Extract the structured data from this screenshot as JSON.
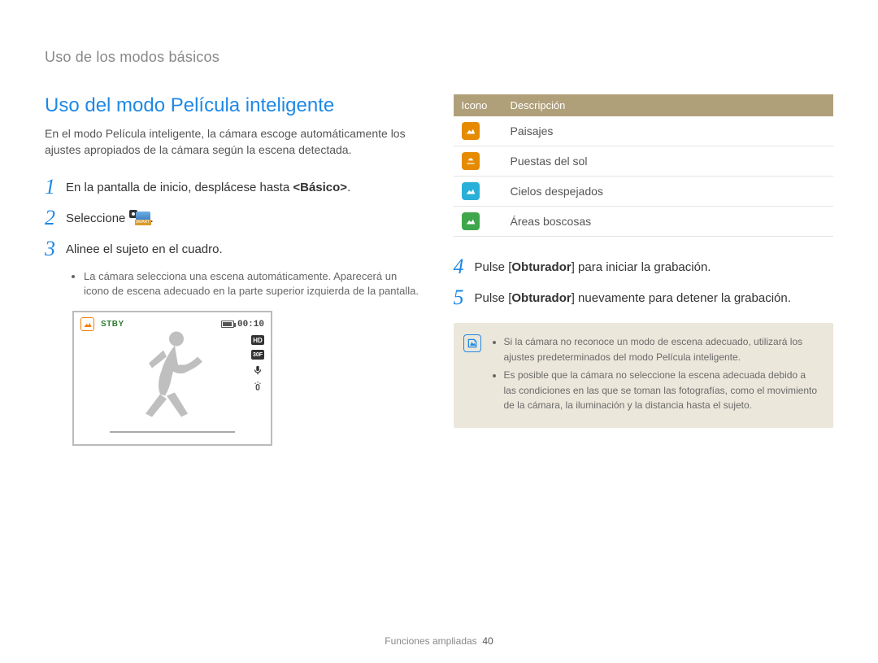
{
  "breadcrumb": "Uso de los modos básicos",
  "title": "Uso del modo Película inteligente",
  "intro": "En el modo Película inteligente, la cámara escoge automáticamente los ajustes apropiados de la cámara según la escena detectada.",
  "steps": {
    "s1_pre": "En la pantalla de inicio, desplácese hasta ",
    "s1_bold": "<Básico>",
    "s1_post": ".",
    "s2": "Seleccione ",
    "smart_label": "SMART",
    "s3": "Alinee el sujeto en el cuadro.",
    "s3_bullet": "La cámara selecciona una escena automáticamente. Aparecerá un icono de escena adecuado en la parte superior izquierda de la pantalla.",
    "s4_pre": "Pulse [",
    "s4_bold": "Obturador",
    "s4_post": "] para iniciar la grabación.",
    "s5_pre": "Pulse [",
    "s5_bold": "Obturador",
    "s5_post": "] nuevamente para detener la grabación."
  },
  "lcd": {
    "stby": "STBY",
    "time": "00:10",
    "hd": "HD",
    "fps": "30F"
  },
  "table": {
    "head_icon": "Icono",
    "head_desc": "Descripción",
    "rows": [
      {
        "color": "#e68a00",
        "desc": "Paisajes"
      },
      {
        "color": "#e68a00",
        "desc": "Puestas del sol"
      },
      {
        "color": "#29b0d9",
        "desc": "Cielos despejados"
      },
      {
        "color": "#3fa64b",
        "desc": "Áreas boscosas"
      }
    ]
  },
  "notes": {
    "n1": "Si la cámara no reconoce un modo de escena adecuado, utilizará los ajustes predeterminados del modo Película inteligente.",
    "n2": "Es posible que la cámara no seleccione la escena adecuada debido a las condiciones en las que se toman las fotografías, como el movimiento de la cámara, la iluminación y la distancia hasta el sujeto."
  },
  "footer": {
    "section": "Funciones ampliadas",
    "page": "40"
  }
}
